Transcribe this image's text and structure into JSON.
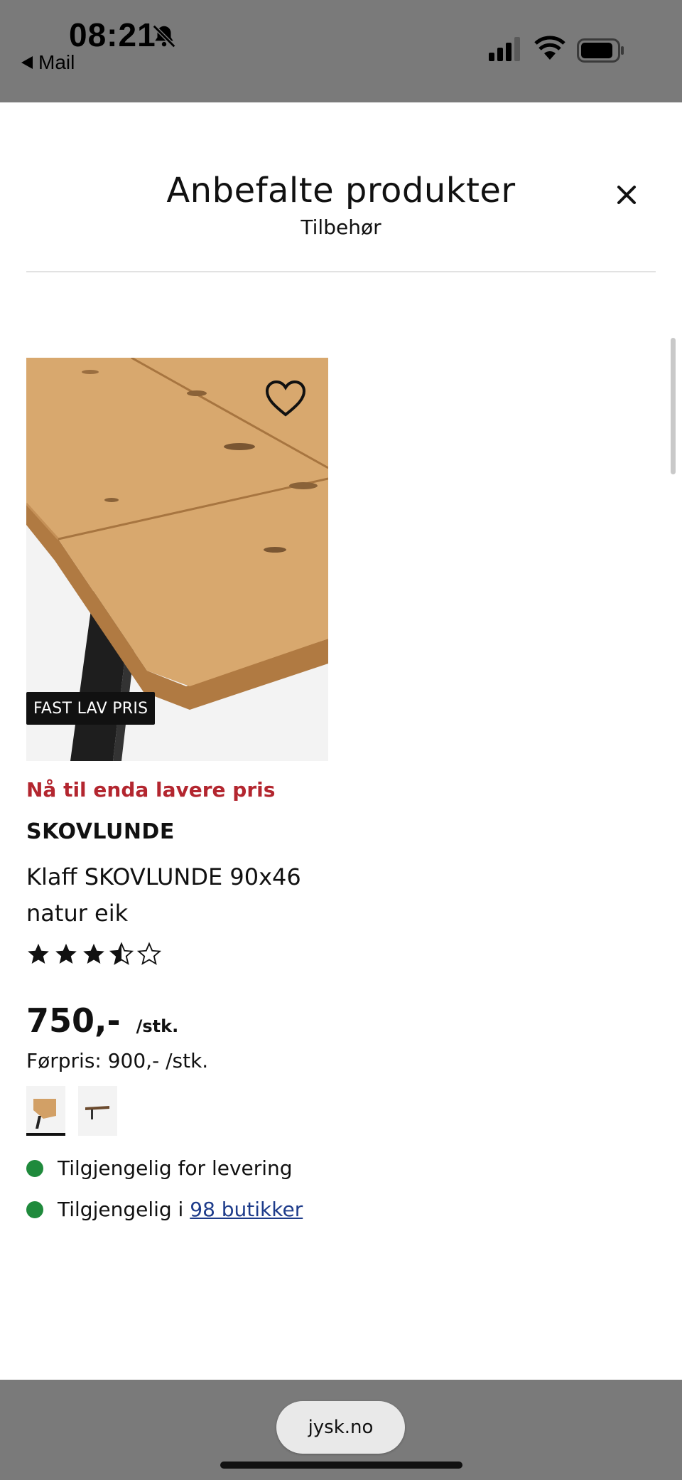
{
  "status_bar": {
    "time": "08:21",
    "back_label": "Mail",
    "icons": [
      "bell-slash-icon",
      "signal-icon",
      "wifi-icon",
      "battery-icon"
    ]
  },
  "modal": {
    "title": "Anbefalte produkter",
    "subtitle": "Tilbehør",
    "close_icon": "close-icon"
  },
  "product": {
    "badge": "FAST LAV PRIS",
    "promo": "Nå til enda lavere pris",
    "brand": "SKOVLUNDE",
    "name": "Klaff SKOVLUNDE 90x46 natur eik",
    "rating": 3.5,
    "rating_max": 5,
    "price": "750,-",
    "price_unit": "/stk.",
    "old_price": "Førpris: 900,- /stk.",
    "variants_selected_index": 0,
    "availability": [
      {
        "text": "Tilgjengelig for levering",
        "link": ""
      },
      {
        "text": "Tilgjengelig i ",
        "link": "98 butikker"
      }
    ],
    "colors": {
      "promo": "#b3262f",
      "available": "#1f8a3c",
      "link": "#1d3b8a"
    }
  },
  "browser": {
    "url": "jysk.no"
  }
}
